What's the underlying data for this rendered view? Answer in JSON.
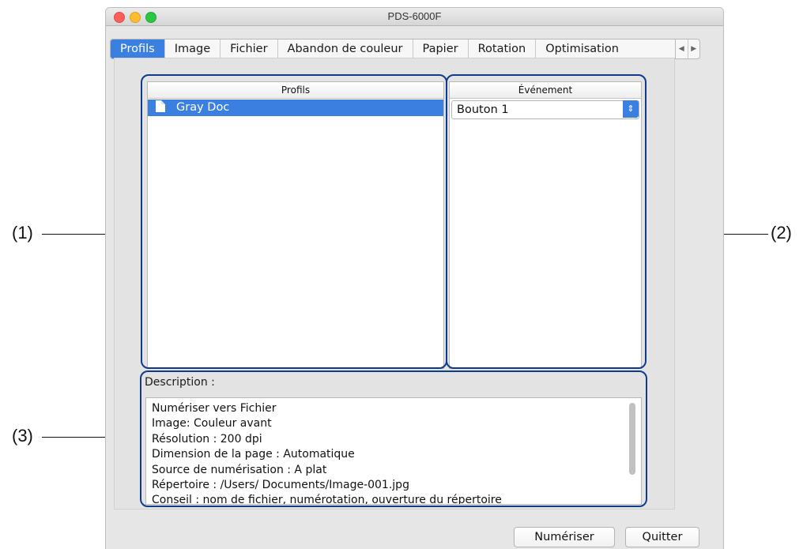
{
  "window": {
    "title": "PDS-6000F"
  },
  "tabs": [
    {
      "label": "Profils",
      "active": true
    },
    {
      "label": "Image",
      "active": false
    },
    {
      "label": "Fichier",
      "active": false
    },
    {
      "label": "Abandon de couleur",
      "active": false
    },
    {
      "label": "Papier",
      "active": false
    },
    {
      "label": "Rotation",
      "active": false
    },
    {
      "label": "Optimisation",
      "active": false
    }
  ],
  "tab_scroll": {
    "left_icon": "scroll-left-icon",
    "right_icon": "scroll-right-icon"
  },
  "profiles_panel": {
    "header": "Profils",
    "items": [
      {
        "name": "Gray Doc",
        "icon": "document-icon",
        "selected": true
      }
    ]
  },
  "event_panel": {
    "header": "Événement",
    "selected": "Bouton 1",
    "arrow_icon": "updown-chevron-icon"
  },
  "description": {
    "label": "Description :",
    "lines": [
      "Numériser vers Fichier",
      "Image: Couleur avant",
      "Résolution : 200 dpi",
      "Dimension de la page : Automatique",
      "Source de numérisation : A plat",
      "Répertoire : /Users/ Documents/Image-001.jpg",
      "Conseil : nom de fichier, numérotation, ouverture du répertoire"
    ]
  },
  "buttons": {
    "scan": "Numériser",
    "quit": "Quitter"
  },
  "callouts": {
    "c1": "(1)",
    "c2": "(2)",
    "c3": "(3)"
  },
  "colors": {
    "accent": "#3b80e0",
    "callout_border": "#0e3b8c"
  }
}
